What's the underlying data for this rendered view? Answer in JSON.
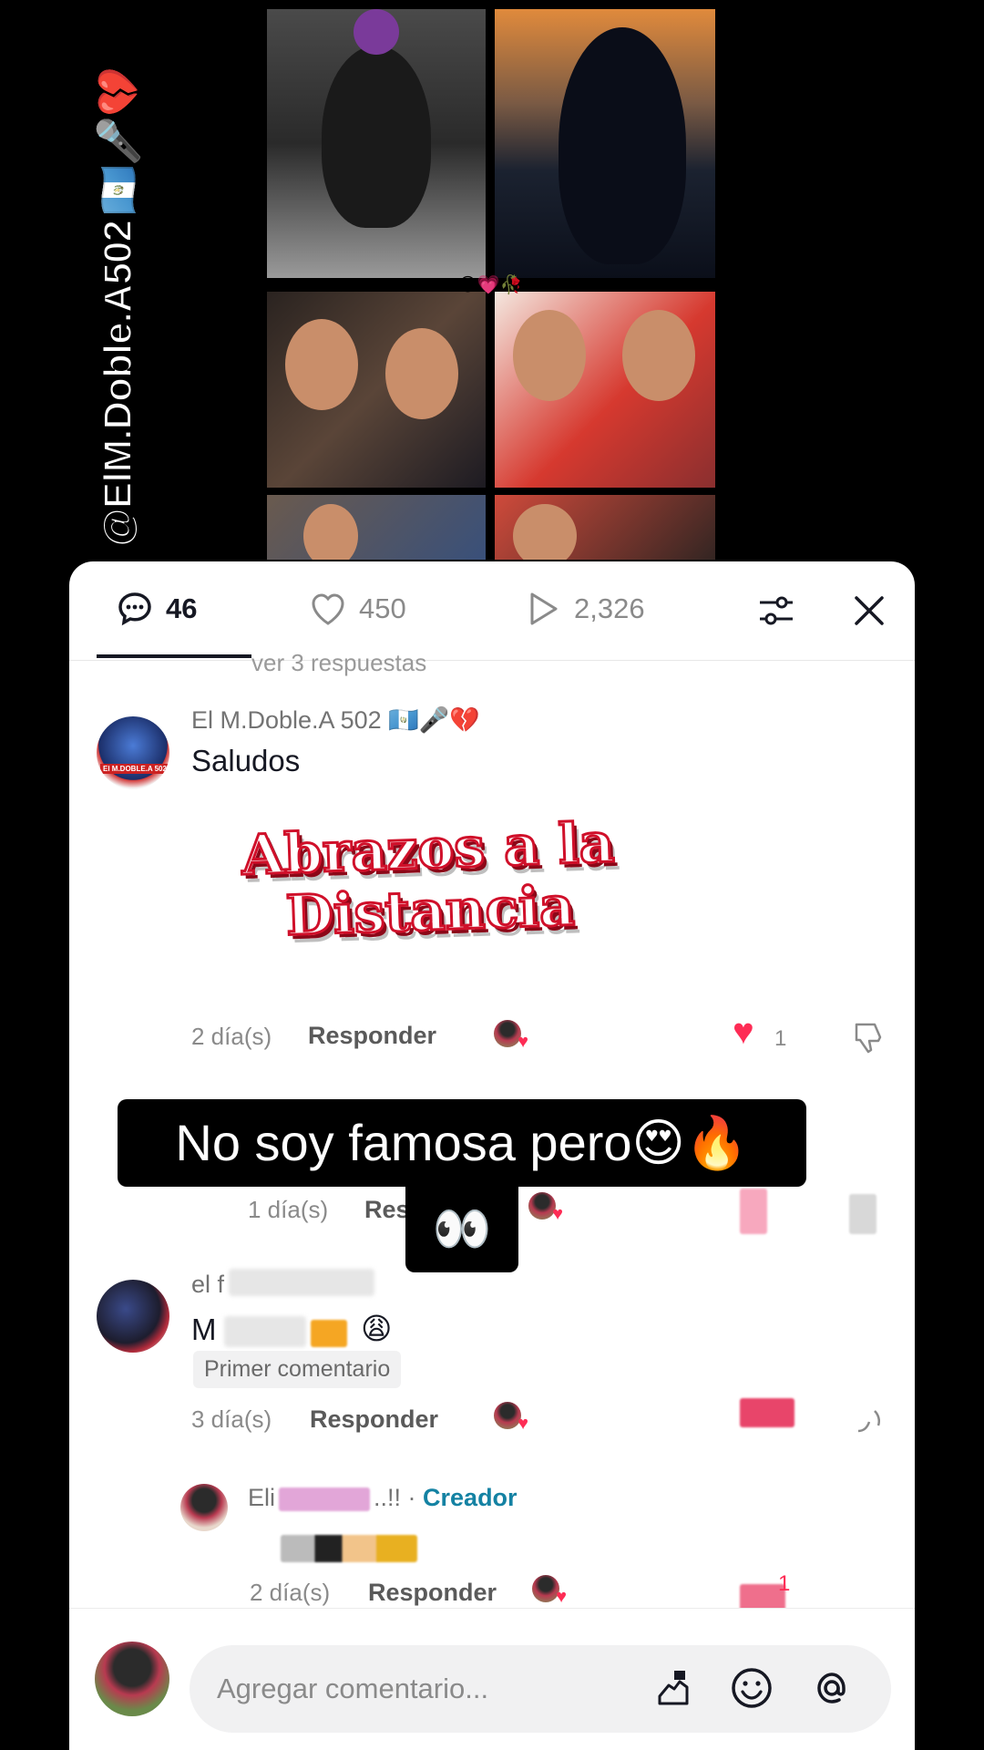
{
  "watermark": {
    "handle": "@ElM.Doble.A502",
    "emojis": "🇬🇹🎤💔"
  },
  "video": {
    "center_emojis": "😩💗🥀"
  },
  "tabs": {
    "comments_count": "46",
    "likes_count": "450",
    "plays_count": "2,326"
  },
  "scroll_ghost": "ver 3 respuestas",
  "comments": [
    {
      "username": "El M.Doble.A 502 🇬🇹🎤💔",
      "text": "Saludos",
      "sticker_line1": "Abrazos a la",
      "sticker_line2": "Distancia",
      "time": "2 día(s)",
      "reply_label": "Responder",
      "like_count": "1",
      "avatar_text": "El M.DOBLE.A 502"
    },
    {
      "time": "1 día(s)",
      "reply_label": "Res"
    },
    {
      "username": "el f",
      "text": "M",
      "text_emoji": "😩",
      "badge": "Primer comentario",
      "time": "3 día(s)",
      "reply_label": "Responder"
    },
    {
      "username": "Eli",
      "username_suffix": "..!! ·",
      "creator_label": "Creador",
      "time": "2 día(s)",
      "reply_label": "Responder",
      "like_count": "1"
    }
  ],
  "input": {
    "placeholder": "Agregar comentario..."
  },
  "overlay": {
    "caption": "No soy famosa pero😍🔥",
    "eyes": "👀"
  },
  "colors": {
    "accent": "#fe2c55",
    "creator": "#1482a3",
    "text": "#161823"
  }
}
